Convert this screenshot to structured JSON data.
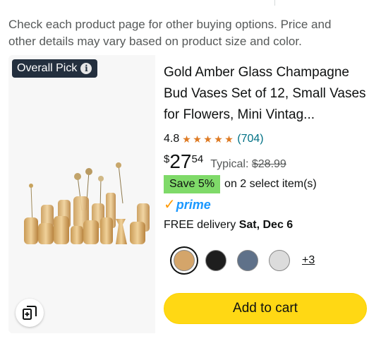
{
  "notice": {
    "text": "Check each product page for other buying options. Price and other details may vary based on product size and color."
  },
  "product": {
    "badge_label": "Overall Pick",
    "badge_icon": "info-icon",
    "image_alt": "gold amber glass bud vases",
    "title": "Gold Amber Glass Champagne Bud Vases Set of 12, Small Vases for Flowers, Mini Vintag...",
    "rating_value": "4.8",
    "rating_stars": 4.8,
    "rating_count": "(704)",
    "price_symbol": "$",
    "price_whole": "27",
    "price_fraction": "54",
    "typical_label": "Typical: ",
    "typical_price": "$28.99",
    "save_badge": "Save 5%",
    "save_text": "on 2 select item(s)",
    "prime_label": "prime",
    "delivery_prefix": "FREE delivery ",
    "delivery_date": "Sat, Dec 6",
    "swatches": [
      {
        "name": "amber",
        "color": "#d4a56a",
        "selected": true
      },
      {
        "name": "black",
        "color": "#1e1e1e",
        "selected": false
      },
      {
        "name": "blue-gray",
        "color": "#5f7189",
        "selected": false
      },
      {
        "name": "clear",
        "color": "#dcdcdc",
        "selected": false
      }
    ],
    "more_swatches": "+3",
    "add_to_cart": "Add to cart",
    "compare_icon": "compare-icon"
  },
  "colors": {
    "star": "#de7921",
    "link": "#007185",
    "save_green": "#7fda69",
    "prime_blue": "#1a98ff",
    "cart_yellow": "#ffd814",
    "badge_bg": "#232f3e"
  }
}
